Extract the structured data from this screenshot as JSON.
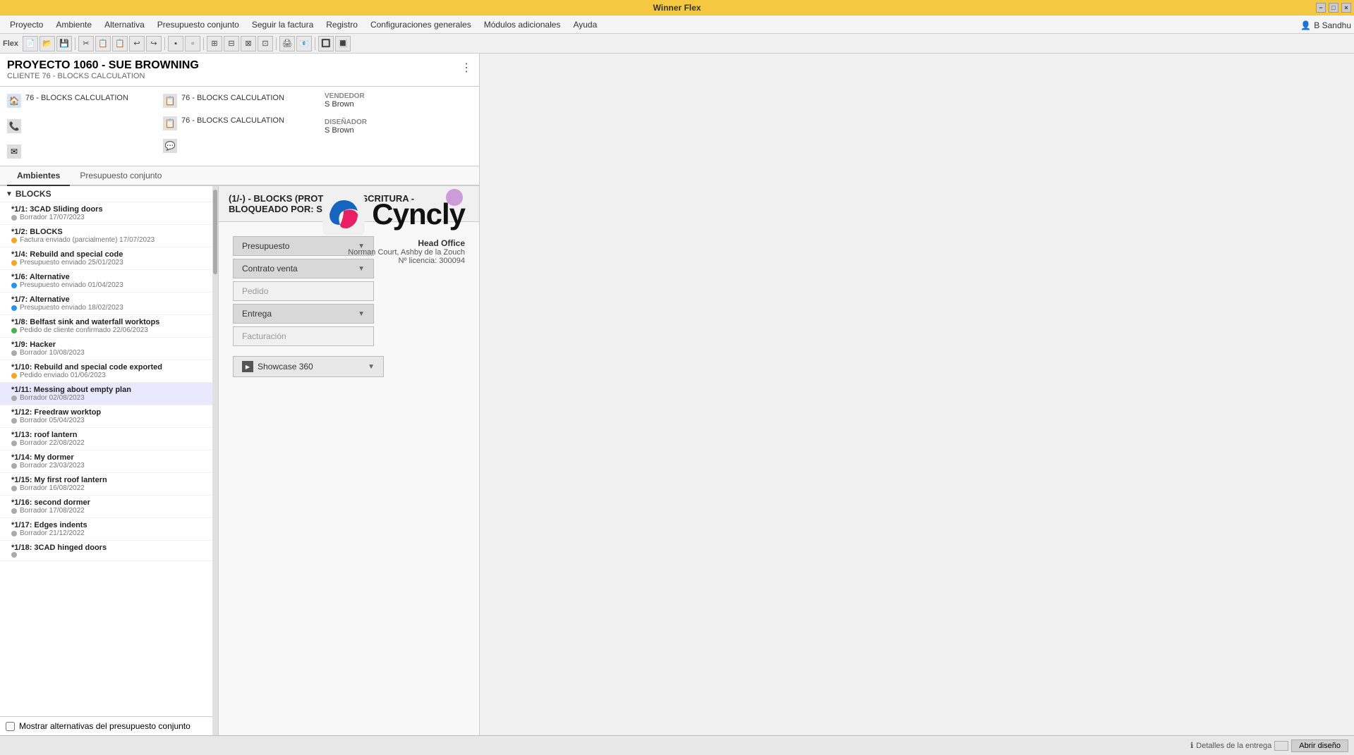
{
  "titleBar": {
    "title": "Winner Flex",
    "windowControls": [
      "−",
      "□",
      "×"
    ]
  },
  "menuBar": {
    "items": [
      "Proyecto",
      "Ambiente",
      "Alternativa",
      "Presupuesto conjunto",
      "Seguir la factura",
      "Registro",
      "Configuraciones generales",
      "Módulos adicionales",
      "Ayuda"
    ]
  },
  "toolbar": {
    "logoLabel": "Flex"
  },
  "profile": {
    "label": "B Sandhu"
  },
  "project": {
    "title": "PROYECTO 1060 - SUE BROWNING",
    "subtitle": "CLIENTE 76 - BLOCKS CALCULATION"
  },
  "projectInfo": {
    "col1": [
      {
        "icon": "🏠",
        "text": "76 - BLOCKS CALCULATION"
      }
    ],
    "col2": [
      {
        "label": "",
        "icon": "📋",
        "text": "76 - BLOCKS CALCULATION"
      },
      {
        "icon": "📋",
        "text": "76 - BLOCKS CALCULATION"
      }
    ],
    "col3": [
      {
        "label": "VENDEDOR",
        "value": "S Brown"
      },
      {
        "label": "DISEÑADOR",
        "value": "S Brown"
      }
    ],
    "icons": [
      "🏠",
      "📞",
      "✉",
      "📋",
      "💬"
    ]
  },
  "tabs": {
    "items": [
      {
        "label": "Ambientes",
        "active": true
      },
      {
        "label": "Presupuesto conjunto",
        "active": false
      }
    ]
  },
  "sidebar": {
    "sectionLabel": "BLOCKS",
    "items": [
      {
        "id": "1/1",
        "title": "*1/1: 3CAD Sliding doors",
        "date": "Borrador 17/07/2023",
        "dotClass": "dot-gray"
      },
      {
        "id": "1/2",
        "title": "*1/2: BLOCKS",
        "date": "Factura enviado (parcialmente) 17/07/2023",
        "dotClass": "dot-orange"
      },
      {
        "id": "1/4",
        "title": "*1/4: Rebuild and special code",
        "date": "Presupuesto enviado 25/01/2023",
        "dotClass": "dot-orange"
      },
      {
        "id": "1/6",
        "title": "*1/6: Alternative",
        "date": "Presupuesto enviado 01/04/2023",
        "dotClass": "dot-blue"
      },
      {
        "id": "1/7",
        "title": "*1/7: Alternative",
        "date": "Presupuesto enviado 18/02/2023",
        "dotClass": "dot-blue"
      },
      {
        "id": "1/8",
        "title": "*1/8: Belfast sink and waterfall worktops",
        "date": "Pedido de cliente confirmado 22/06/2023",
        "dotClass": "dot-green"
      },
      {
        "id": "1/9",
        "title": "*1/9: Hacker",
        "date": "Borrador 10/08/2023",
        "dotClass": "dot-gray"
      },
      {
        "id": "1/10",
        "title": "*1/10: Rebuild and special code exported",
        "date": "Pedido enviado 01/06/2023",
        "dotClass": "dot-orange"
      },
      {
        "id": "1/11",
        "title": "*1/11: Messing about empty plan",
        "date": "Borrador 02/08/2023",
        "dotClass": "dot-gray"
      },
      {
        "id": "1/12",
        "title": "*1/12: Freedraw worktop",
        "date": "Borrador 05/04/2023",
        "dotClass": "dot-gray"
      },
      {
        "id": "1/13",
        "title": "*1/13: roof lantern",
        "date": "Borrador 22/08/2022",
        "dotClass": "dot-gray"
      },
      {
        "id": "1/14",
        "title": "*1/14: My dormer",
        "date": "Borrador 23/03/2023",
        "dotClass": "dot-gray"
      },
      {
        "id": "1/15",
        "title": "*1/15: My first roof lantern",
        "date": "Borrador 16/08/2022",
        "dotClass": "dot-gray"
      },
      {
        "id": "1/16",
        "title": "*1/16: second dormer",
        "date": "Borrador 17/08/2022",
        "dotClass": "dot-gray"
      },
      {
        "id": "1/17",
        "title": "*1/17: Edges indents",
        "date": "Borrador 21/12/2022",
        "dotClass": "dot-gray"
      },
      {
        "id": "1/18",
        "title": "*1/18: 3CAD hinged doors",
        "date": "",
        "dotClass": "dot-gray"
      }
    ]
  },
  "contentHeader": {
    "text": "(1/-) - BLOCKS (PROTEGIDO ESCRITURA - BLOQUEADO POR: S BROWN)"
  },
  "workflow": {
    "items": [
      {
        "label": "Presupuesto",
        "enabled": true
      },
      {
        "label": "Contrato venta",
        "enabled": true
      },
      {
        "label": "Pedido",
        "enabled": false
      },
      {
        "label": "Entrega",
        "enabled": true
      },
      {
        "label": "Facturación",
        "enabled": false
      }
    ],
    "showcase": {
      "label": "Showcase 360",
      "icon": "▶"
    }
  },
  "cyncly": {
    "company": "Head Office",
    "address": "Norman Court,  Ashby de la Zouch",
    "license": "Nº licencia: 300094"
  },
  "checkbox": {
    "label": "Mostrar alternativas del presupuesto conjunto"
  },
  "bottomBar": {
    "deliveryDetails": "Detalles de la entrega",
    "openButton": "Abrir diseño"
  }
}
